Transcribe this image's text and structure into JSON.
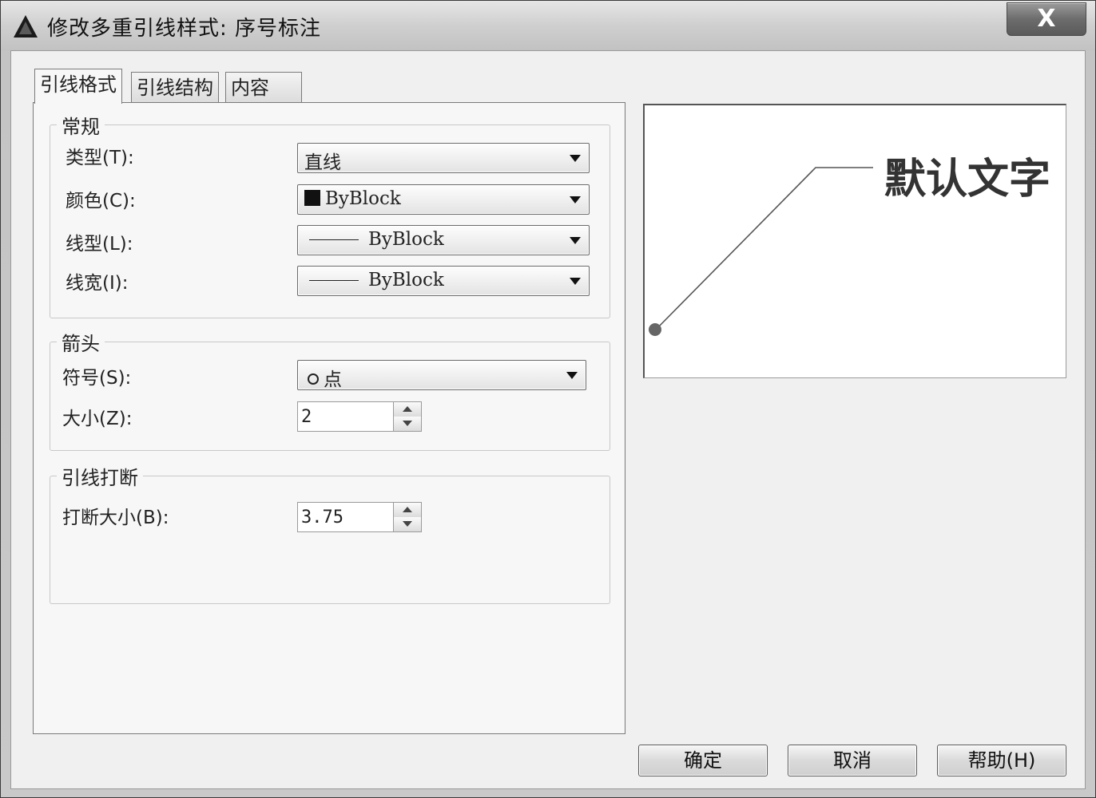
{
  "window": {
    "title": "修改多重引线样式: 序号标注",
    "close_label": "X"
  },
  "tabs": [
    {
      "label": "引线格式",
      "active": true
    },
    {
      "label": "引线结构",
      "active": false
    },
    {
      "label": "内容",
      "active": false
    }
  ],
  "general": {
    "legend": "常规",
    "type_label": "类型(T):",
    "type_value": "直线",
    "color_label": "颜色(C):",
    "color_value": "ByBlock",
    "color_swatch": "#111111",
    "linetype_label": "线型(L):",
    "linetype_value": "ByBlock",
    "lineweight_label": "线宽(I):",
    "lineweight_value": "ByBlock"
  },
  "arrowhead": {
    "legend": "箭头",
    "symbol_label": "符号(S):",
    "symbol_value": "点",
    "size_label": "大小(Z):",
    "size_value": "2"
  },
  "leader_break": {
    "legend": "引线打断",
    "break_size_label": "打断大小(B):",
    "break_size_value": "3.75"
  },
  "preview": {
    "text": "默认文字"
  },
  "buttons": {
    "ok": "确定",
    "cancel": "取消",
    "help": "帮助(H)"
  }
}
